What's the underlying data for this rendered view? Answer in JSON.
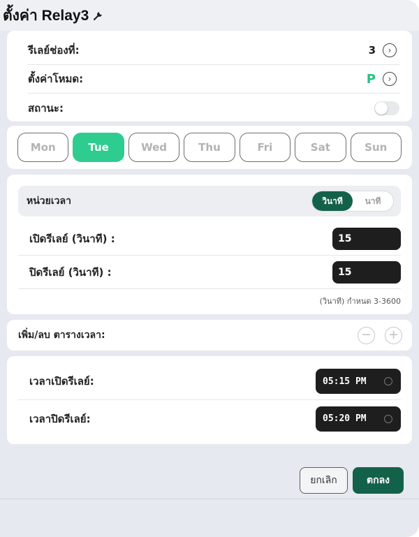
{
  "header": {
    "title": "ตั้งค่า Relay3",
    "icon": "wrench-icon"
  },
  "info": {
    "channel_label": "รีเลย์ช่องที่:",
    "channel_value": "3",
    "mode_label": "ตั้งค่าโหมด:",
    "mode_value": "P",
    "status_label": "สถานะ:",
    "status_on": false
  },
  "days": [
    {
      "label": "Mon",
      "active": false
    },
    {
      "label": "Tue",
      "active": true
    },
    {
      "label": "Wed",
      "active": false
    },
    {
      "label": "Thu",
      "active": false
    },
    {
      "label": "Fri",
      "active": false
    },
    {
      "label": "Sat",
      "active": false
    },
    {
      "label": "Sun",
      "active": false
    }
  ],
  "timing": {
    "unit_label": "หน่วยเวลา",
    "unit_seconds": "วินาที",
    "unit_minutes": "นาที",
    "selected_unit": "วินาที",
    "on_delay_label": "เปิดรีเลย์ (วินาที) :",
    "on_delay_value": "15",
    "off_delay_label": "ปิดรีเลย์ (วินาที) :",
    "off_delay_value": "15",
    "hint": "(วินาที) กำหนด 3-3600"
  },
  "schedule": {
    "label": "เพิ่ม/ลบ ตารางเวลา:",
    "remove_symbol": "−",
    "add_symbol": "+",
    "on_time_label": "เวลาเปิดรีเลย์:",
    "on_time_value": "05:15 PM",
    "off_time_label": "เวลาปิดรีเลย์:",
    "off_time_value": "05:20 PM"
  },
  "footer": {
    "cancel_label": "ยกเลิก",
    "ok_label": "ตกลง"
  },
  "colors": {
    "accent": "#2ecc8f",
    "primary": "#14614a",
    "mode": "#26c281",
    "input_bg": "#1e1e1e"
  }
}
